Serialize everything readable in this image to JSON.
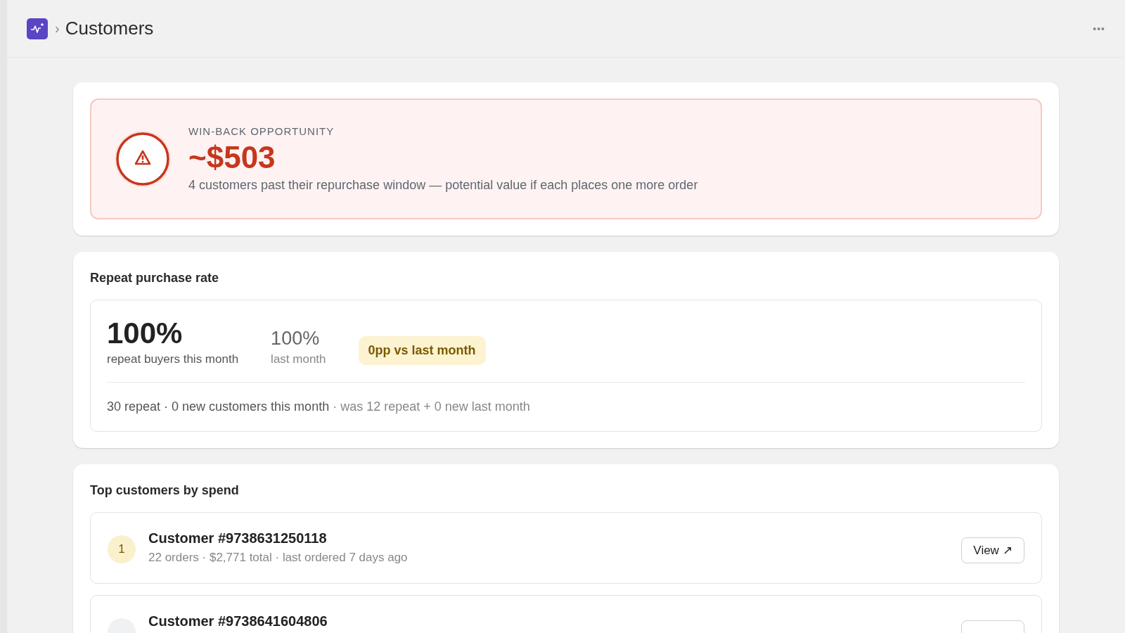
{
  "header": {
    "breadcrumb_separator": "›",
    "title": "Customers",
    "menu": "•••"
  },
  "winback": {
    "label": "WIN-BACK OPPORTUNITY",
    "amount": "~$503",
    "description": "4 customers past their repurchase window — potential value if each places one more order"
  },
  "repeat": {
    "title": "Repeat purchase rate",
    "current": "100%",
    "current_label": "repeat buyers this month",
    "previous": "100%",
    "previous_label": "last month",
    "change": "0pp vs last month",
    "summary": "30 repeat · 0 new customers this month",
    "comparison": "· was 12 repeat + 0 new last month"
  },
  "top_customers": {
    "title": "Top customers by spend",
    "rows": [
      {
        "rank": "1",
        "name": "Customer #9738631250118",
        "meta": "22 orders · $2,771 total · last ordered 7 days ago",
        "button": "View ↗",
        "kind": "gold"
      },
      {
        "name": "Customer #9738641604806",
        "kind": "plain"
      }
    ]
  }
}
